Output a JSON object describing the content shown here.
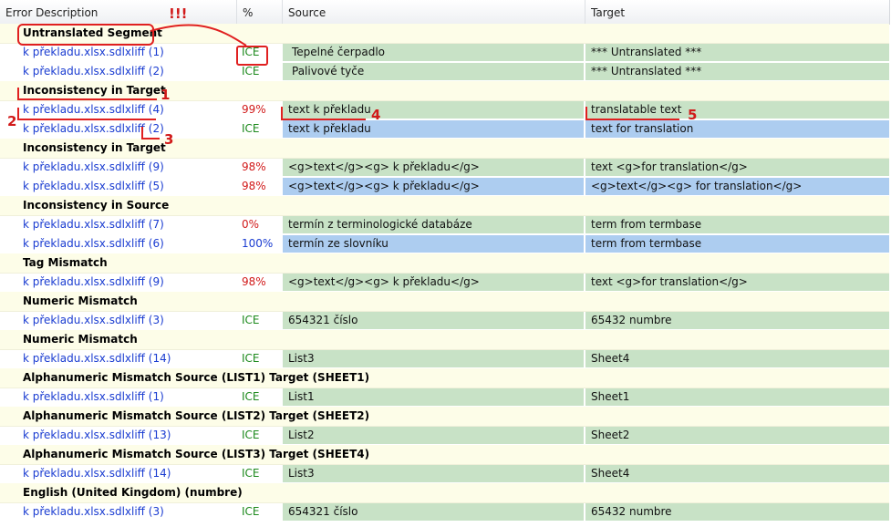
{
  "columns": {
    "error_description": "Error Description",
    "percent": "%",
    "source": "Source",
    "target": "Target"
  },
  "rows": [
    {
      "kind": "group",
      "label": "Untranslated Segment"
    },
    {
      "kind": "item",
      "file": "k překladu.xlsx.sdlxliff (1)",
      "pct": "ICE",
      "pct_color": "#1e8a1e",
      "source": "Tepelné čerpadlo",
      "target": "*** Untranslated ***",
      "source_bg": "green",
      "target_bg": "green"
    },
    {
      "kind": "item",
      "file": "k překladu.xlsx.sdlxliff (2)",
      "pct": "ICE",
      "pct_color": "#1e8a1e",
      "source": "Palivové tyče",
      "target": "*** Untranslated ***",
      "source_bg": "green",
      "target_bg": "green"
    },
    {
      "kind": "group",
      "label": "Inconsistency in Target"
    },
    {
      "kind": "item",
      "file": "k překladu.xlsx.sdlxliff (4)",
      "pct": "99%",
      "pct_color": "#d11a1a",
      "source": "text k překladu",
      "target": "translatable text",
      "source_bg": "green",
      "target_bg": "green"
    },
    {
      "kind": "item",
      "file": "k překladu.xlsx.sdlxliff (2)",
      "pct": "ICE",
      "pct_color": "#1e8a1e",
      "source": "text k překladu",
      "target": "text for translation",
      "source_bg": "blue",
      "target_bg": "blue"
    },
    {
      "kind": "group",
      "label": "Inconsistency in Target"
    },
    {
      "kind": "item",
      "file": "k překladu.xlsx.sdlxliff (9)",
      "pct": "98%",
      "pct_color": "#d11a1a",
      "source": "<g>text</g><g> k překladu</g>",
      "target": "text <g>for translation</g>",
      "source_bg": "green",
      "target_bg": "green"
    },
    {
      "kind": "item",
      "file": "k překladu.xlsx.sdlxliff (5)",
      "pct": "98%",
      "pct_color": "#d11a1a",
      "source": "<g>text</g><g> k překladu</g>",
      "target": " <g>text</g><g> for translation</g>",
      "source_bg": "blue",
      "target_bg": "blue"
    },
    {
      "kind": "group",
      "label": "Inconsistency in Source"
    },
    {
      "kind": "item",
      "file": "k překladu.xlsx.sdlxliff (7)",
      "pct": "0%",
      "pct_color": "#d11a1a",
      "source": "termín z terminologické databáze",
      "target": "term from termbase",
      "source_bg": "green",
      "target_bg": "green"
    },
    {
      "kind": "item",
      "file": "k překladu.xlsx.sdlxliff (6)",
      "pct": "100%",
      "pct_color": "#1a3cd1",
      "source": "termín ze slovníku",
      "target": "term from termbase",
      "source_bg": "blue",
      "target_bg": "blue"
    },
    {
      "kind": "group",
      "label": "Tag Mismatch"
    },
    {
      "kind": "item",
      "file": "k překladu.xlsx.sdlxliff (9)",
      "pct": "98%",
      "pct_color": "#d11a1a",
      "source": "<g>text</g><g> k překladu</g>",
      "target": "text <g>for translation</g>",
      "source_bg": "green",
      "target_bg": "green"
    },
    {
      "kind": "group",
      "label": "Numeric Mismatch"
    },
    {
      "kind": "item",
      "file": "k překladu.xlsx.sdlxliff (3)",
      "pct": "ICE",
      "pct_color": "#1e8a1e",
      "source": "654321 číslo",
      "target": "65432 numbre",
      "source_bg": "green",
      "target_bg": "green"
    },
    {
      "kind": "group",
      "label": "Numeric Mismatch"
    },
    {
      "kind": "item",
      "file": "k překladu.xlsx.sdlxliff (14)",
      "pct": "ICE",
      "pct_color": "#1e8a1e",
      "source": "List3",
      "target": "Sheet4",
      "source_bg": "green",
      "target_bg": "green"
    },
    {
      "kind": "group",
      "label": "Alphanumeric Mismatch Source (LIST1) Target (SHEET1)"
    },
    {
      "kind": "item",
      "file": "k překladu.xlsx.sdlxliff (1)",
      "pct": "ICE",
      "pct_color": "#1e8a1e",
      "source": "List1",
      "target": "Sheet1",
      "source_bg": "green",
      "target_bg": "green"
    },
    {
      "kind": "group",
      "label": "Alphanumeric Mismatch Source (LIST2) Target (SHEET2)"
    },
    {
      "kind": "item",
      "file": "k překladu.xlsx.sdlxliff (13)",
      "pct": "ICE",
      "pct_color": "#1e8a1e",
      "source": "List2",
      "target": "Sheet2",
      "source_bg": "green",
      "target_bg": "green"
    },
    {
      "kind": "group",
      "label": "Alphanumeric Mismatch Source (LIST3) Target (SHEET4)"
    },
    {
      "kind": "item",
      "file": "k překladu.xlsx.sdlxliff (14)",
      "pct": "ICE",
      "pct_color": "#1e8a1e",
      "source": "List3",
      "target": "Sheet4",
      "source_bg": "green",
      "target_bg": "green"
    },
    {
      "kind": "group",
      "label": "English (United Kingdom) (numbre)"
    },
    {
      "kind": "item",
      "file": "k překladu.xlsx.sdlxliff (3)",
      "pct": "ICE",
      "pct_color": "#1e8a1e",
      "source": "654321 číslo",
      "target": "65432 numbre",
      "source_bg": "green",
      "target_bg": "green"
    }
  ],
  "annotations": {
    "exclaim": "!!!",
    "n1": "1",
    "n2": "2",
    "n3": "3",
    "n4": "4",
    "n5": "5"
  },
  "colors": {
    "annotation_red": "#e02020",
    "link_blue": "#1a3cd1",
    "cell_green": "#c8e2c6",
    "cell_blue": "#adcdf0",
    "group_bg": "#fdfde8"
  }
}
